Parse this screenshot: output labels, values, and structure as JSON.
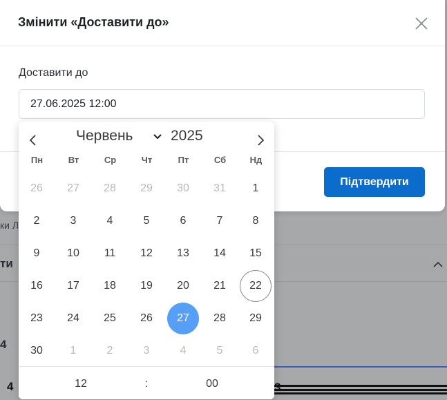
{
  "background": {
    "text_fragment_1": "ки Л",
    "text_fragment_2": "ти",
    "text_fragment_3": "4",
    "text_fragment_4": "4",
    "text_fragment_5": "3"
  },
  "modal": {
    "title": "Змінити «Доставити до»",
    "field_label": "Доставити до",
    "field_value": "27.06.2025 12:00",
    "confirm_label": "Підтвердити",
    "accent_color": "#0b6ccc"
  },
  "calendar": {
    "month": "Червень",
    "year": "2025",
    "weekdays": [
      "Пн",
      "Вт",
      "Ср",
      "Чт",
      "Пт",
      "Сб",
      "Нд"
    ],
    "weeks": [
      [
        "26",
        "27",
        "28",
        "29",
        "30",
        "31",
        "1"
      ],
      [
        "2",
        "3",
        "4",
        "5",
        "6",
        "7",
        "8"
      ],
      [
        "9",
        "10",
        "11",
        "12",
        "13",
        "14",
        "15"
      ],
      [
        "16",
        "17",
        "18",
        "19",
        "20",
        "21",
        "22"
      ],
      [
        "23",
        "24",
        "25",
        "26",
        "27",
        "28",
        "29"
      ],
      [
        "30",
        "1",
        "2",
        "3",
        "4",
        "5",
        "6"
      ]
    ],
    "muted_days": [
      [
        0,
        0
      ],
      [
        0,
        1
      ],
      [
        0,
        2
      ],
      [
        0,
        3
      ],
      [
        0,
        4
      ],
      [
        0,
        5
      ],
      [
        5,
        1
      ],
      [
        5,
        2
      ],
      [
        5,
        3
      ],
      [
        5,
        4
      ],
      [
        5,
        5
      ],
      [
        5,
        6
      ]
    ],
    "today": [
      3,
      6
    ],
    "selected": [
      4,
      4
    ],
    "selected_color": "#569ff7",
    "time": {
      "hours": "12",
      "separator": ":",
      "minutes": "00"
    }
  }
}
